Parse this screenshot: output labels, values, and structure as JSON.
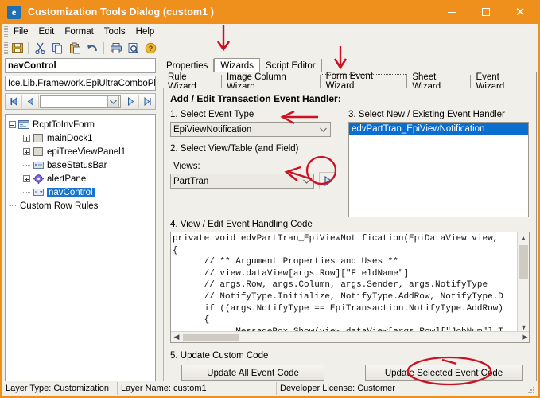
{
  "window": {
    "title": "Customization Tools Dialog  (custom1 )",
    "icon": "e",
    "accent_color": "#ef8f1c",
    "minimize_label": "minimize",
    "maximize_label": "maximize",
    "close_label": "close"
  },
  "menu": {
    "items": [
      "File",
      "Edit",
      "Format",
      "Tools",
      "Help"
    ]
  },
  "toolbar": {
    "buttons": [
      {
        "name": "save-icon",
        "glyph": "💾"
      },
      {
        "name": "cut-icon",
        "glyph": "✂"
      },
      {
        "name": "copy-icon",
        "glyph": "⧉"
      },
      {
        "name": "paste-icon",
        "glyph": "📋"
      },
      {
        "name": "undo-icon",
        "glyph": "↶"
      },
      {
        "name": "print-icon",
        "glyph": "🖶"
      },
      {
        "name": "print-preview-icon",
        "glyph": "🔍"
      },
      {
        "name": "help-icon",
        "glyph": "?"
      }
    ]
  },
  "left_panel": {
    "control_name": "navControl",
    "control_type": "Ice.Lib.Framework.EpiUltraComboPlus",
    "nav": {
      "first_label": "first",
      "prev_label": "previous",
      "combo_value": "",
      "next_label": "next",
      "last_label": "last"
    },
    "tree": [
      {
        "label": "RcptToInvForm",
        "indent": 0,
        "toggle": "minus",
        "icon": "form-icon",
        "selected": false
      },
      {
        "label": "mainDock1",
        "indent": 1,
        "toggle": "plus",
        "icon": "panel-icon",
        "selected": false
      },
      {
        "label": "epiTreeViewPanel1",
        "indent": 1,
        "toggle": "plus",
        "icon": "panel-icon",
        "selected": false
      },
      {
        "label": "baseStatusBar",
        "indent": 1,
        "toggle": "none",
        "icon": "status-icon",
        "selected": false
      },
      {
        "label": "alertPanel",
        "indent": 1,
        "toggle": "plus",
        "icon": "gear-icon",
        "selected": false
      },
      {
        "label": "navControl",
        "indent": 1,
        "toggle": "none",
        "icon": "combo-icon",
        "selected": true
      },
      {
        "label": "Custom Row Rules",
        "indent": 0,
        "toggle": "none",
        "icon": "none",
        "selected": false
      }
    ]
  },
  "outer_tabs": [
    {
      "label": "Properties",
      "active": false
    },
    {
      "label": "Wizards",
      "active": true
    },
    {
      "label": "Script Editor",
      "active": false
    }
  ],
  "inner_tabs": [
    {
      "label": "Rule Wizard",
      "active": false
    },
    {
      "label": "Image Column Wizard",
      "active": false
    },
    {
      "label": "Form Event Wizard",
      "active": true
    },
    {
      "label": "Sheet Wizard",
      "active": false
    },
    {
      "label": "Event Wizard",
      "active": false
    }
  ],
  "wizard": {
    "section_title": "Add / Edit Transaction Event Handler:",
    "step1_label": "1. Select Event Type",
    "event_type_value": "EpiViewNotification",
    "step2_label": "2. Select View/Table (and Field)",
    "views_label": "Views:",
    "views_value": "PartTran",
    "view_go_label": "apply-view",
    "step3_label": "3. Select New / Existing Event Handler",
    "handlers": [
      "edvPartTran_EpiViewNotification"
    ],
    "step4_label": "4. View / Edit Event Handling Code",
    "code": "private void edvPartTran_EpiViewNotification(EpiDataView view,\n{\n      // ** Argument Properties and Uses **\n      // view.dataView[args.Row][\"FieldName\"]\n      // args.Row, args.Column, args.Sender, args.NotifyType\n      // NotifyType.Initialize, NotifyType.AddRow, NotifyType.D\n      if ((args.NotifyType == EpiTransaction.NotifyType.AddRow)\n      {\n            MessageBox.Show(view.dataView[args.Row][\"JobNum\"].T",
    "step5_label": "5. Update Custom Code",
    "update_all_label": "Update All Event Code",
    "update_selected_label": "Update Selected Event Code"
  },
  "status_bar": {
    "layer_type": "Layer Type:  Customization",
    "layer_name": "Layer Name:  custom1",
    "developer_license": "Developer License:  Customer"
  },
  "annotations": {
    "color": "#cc1122",
    "arrow_wizards_tab": "arrow pointing down to Wizards tab",
    "arrow_form_event_wizard": "arrow pointing down to Form Event Wizard tab",
    "arrow_event_type": "arrow pointing left to Event Type combo",
    "arrow_views": "arrow pointing left to Views combo",
    "circle_view_go": "circle around view apply arrow button",
    "circle_update_selected": "circle around Update Selected Event Code button"
  }
}
